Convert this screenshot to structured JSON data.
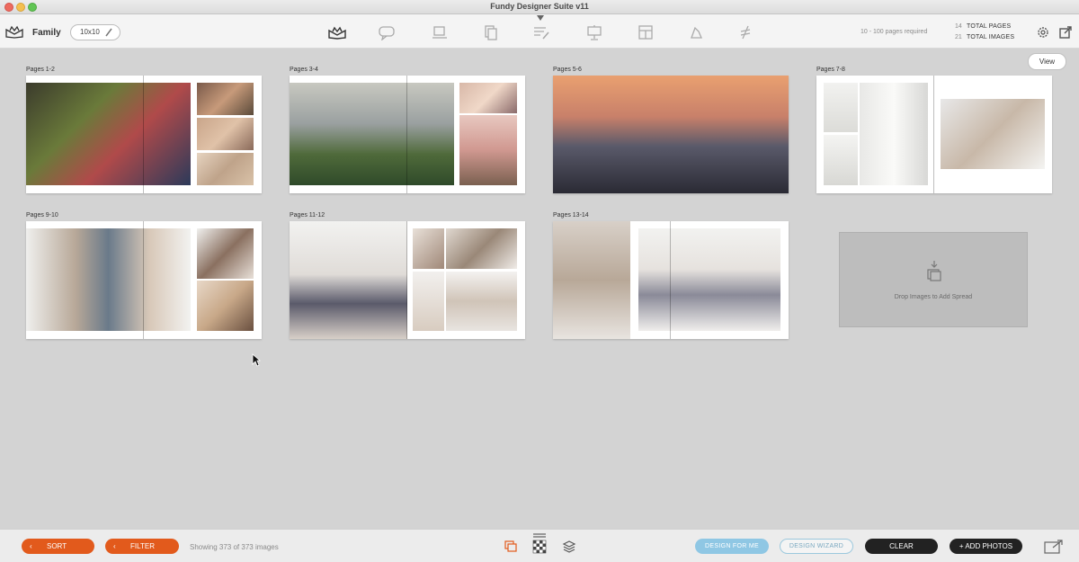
{
  "window": {
    "title": "Fundy Designer Suite v11"
  },
  "toolbar": {
    "album_name": "Family",
    "album_size": "10x10",
    "pages_required": "10 - 100 pages required",
    "total_pages_value": "14",
    "total_pages_label": "TOTAL PAGES",
    "total_images_value": "21",
    "total_images_label": "TOTAL IMAGES",
    "tools": [
      "album-icon",
      "proofing-icon",
      "wall-art-icon",
      "cards-icon",
      "text-edit-icon",
      "slideshow-icon",
      "layout-icon",
      "blog-icon",
      "social-icon"
    ]
  },
  "view_button": "View",
  "spreads": [
    {
      "label": "Pages 1-2"
    },
    {
      "label": "Pages 3-4"
    },
    {
      "label": "Pages 5-6"
    },
    {
      "label": "Pages 7-8"
    },
    {
      "label": "Pages 9-10"
    },
    {
      "label": "Pages 11-12"
    },
    {
      "label": "Pages 13-14"
    }
  ],
  "drop_zone": "Drop Images to Add Spread",
  "bottom": {
    "sort": "SORT",
    "filter": "FILTER",
    "showing": "Showing 373 of 373 images",
    "design_for_me": "DESIGN FOR ME",
    "design_wizard": "DESIGN WIZARD",
    "clear": "CLEAR",
    "add_photos": "+ ADD PHOTOS"
  },
  "colors": {
    "accent_orange": "#e25a1c",
    "accent_blue": "#8fc7e4",
    "dark": "#222222"
  }
}
